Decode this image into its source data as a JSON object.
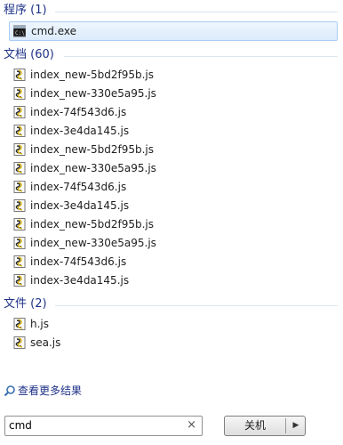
{
  "groups": {
    "programs": {
      "header": "程序 (1)",
      "items": [
        "cmd.exe"
      ]
    },
    "documents": {
      "header": "文档 (60)",
      "items": [
        "index_new-5bd2f95b.js",
        "index_new-330e5a95.js",
        "index-74f543d6.js",
        "index-3e4da145.js",
        "index_new-5bd2f95b.js",
        "index_new-330e5a95.js",
        "index-74f543d6.js",
        "index-3e4da145.js",
        "index_new-5bd2f95b.js",
        "index_new-330e5a95.js",
        "index-74f543d6.js",
        "index-3e4da145.js"
      ]
    },
    "files": {
      "header": "文件 (2)",
      "items": [
        "h.js",
        "sea.js"
      ]
    }
  },
  "more_results": "查看更多结果",
  "search": {
    "value": "cmd",
    "clear": "×"
  },
  "shutdown": {
    "label": "关机",
    "arrow": "▶"
  },
  "icons": {
    "program": "cmd-icon",
    "script": "js-script-icon",
    "search": "search-icon"
  }
}
